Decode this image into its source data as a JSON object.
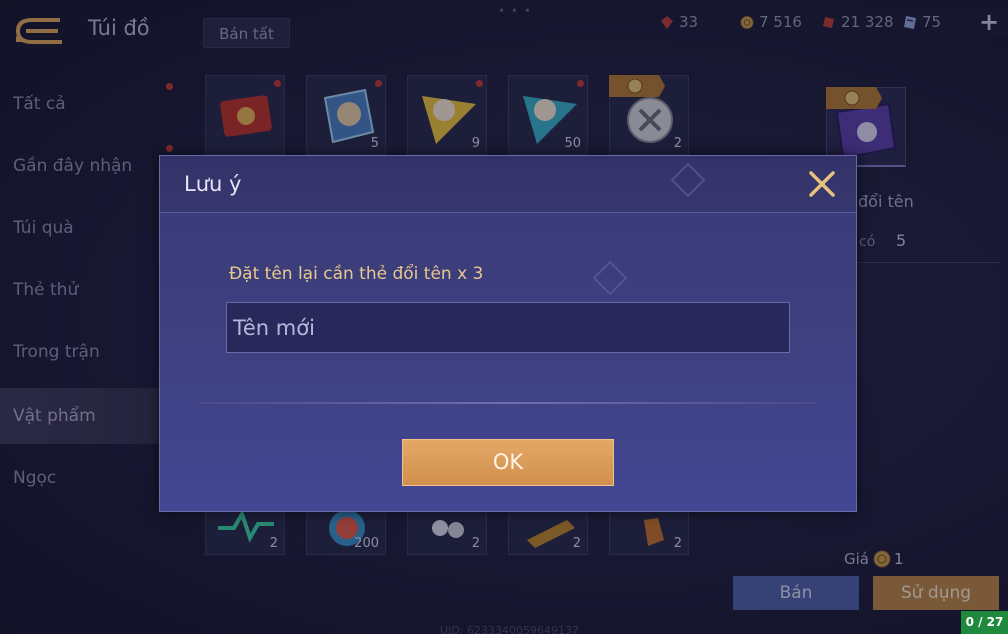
{
  "header": {
    "title": "Túi đồ",
    "sell_all_label": "Bán tất"
  },
  "resources": [
    {
      "icon": "red-gem-icon",
      "value": "33"
    },
    {
      "icon": "gold-coin-icon",
      "value": "7 516"
    },
    {
      "icon": "red-voucher-icon",
      "value": "21 328"
    },
    {
      "icon": "blue-card-icon",
      "value": "75"
    }
  ],
  "sidebar": {
    "items": [
      {
        "label": "Tất cả"
      },
      {
        "label": "Gần đây nhận"
      },
      {
        "label": "Túi quà"
      },
      {
        "label": "Thẻ thử"
      },
      {
        "label": "Trong trận"
      },
      {
        "label": "Vật phẩm"
      },
      {
        "label": "Ngọc"
      }
    ],
    "active_index": 5
  },
  "grid": {
    "row1": [
      {
        "icon": "red-ticket-icon",
        "count": ""
      },
      {
        "icon": "blue-hero-shard-icon",
        "count": "5"
      },
      {
        "icon": "gold-hero-shard-icon",
        "count": "9"
      },
      {
        "icon": "teal-hero-shard-icon",
        "count": "50"
      },
      {
        "icon": "silver-orb-icon",
        "count": "2"
      }
    ],
    "row2": [
      {
        "icon": "green-pulse-icon",
        "count": "2"
      },
      {
        "icon": "fruit-icon",
        "count": "200"
      },
      {
        "icon": "flower-icon",
        "count": "2"
      },
      {
        "icon": "scroll-icon",
        "count": "2"
      },
      {
        "icon": "crystal-icon",
        "count": "2"
      }
    ]
  },
  "detail": {
    "name": "đổi tên",
    "owned_label": "ã có",
    "owned_value": "5",
    "price_label": "Giá",
    "price_value": "1",
    "sell_label": "Bán",
    "use_label": "Sử dụng"
  },
  "counter": "0 / 27",
  "uid": "UID: 6233340059649137",
  "dialog": {
    "title": "Lưu ý",
    "message": "Đặt tên lại cần thẻ đổi tên x 3",
    "input_placeholder": "Tên mới",
    "input_value": "",
    "ok_label": "OK"
  },
  "colors": {
    "accent_gold": "#e7c98d",
    "ok_button": "#d99c5a",
    "sell_button": "#4f60a6",
    "use_button": "#b7854a"
  }
}
